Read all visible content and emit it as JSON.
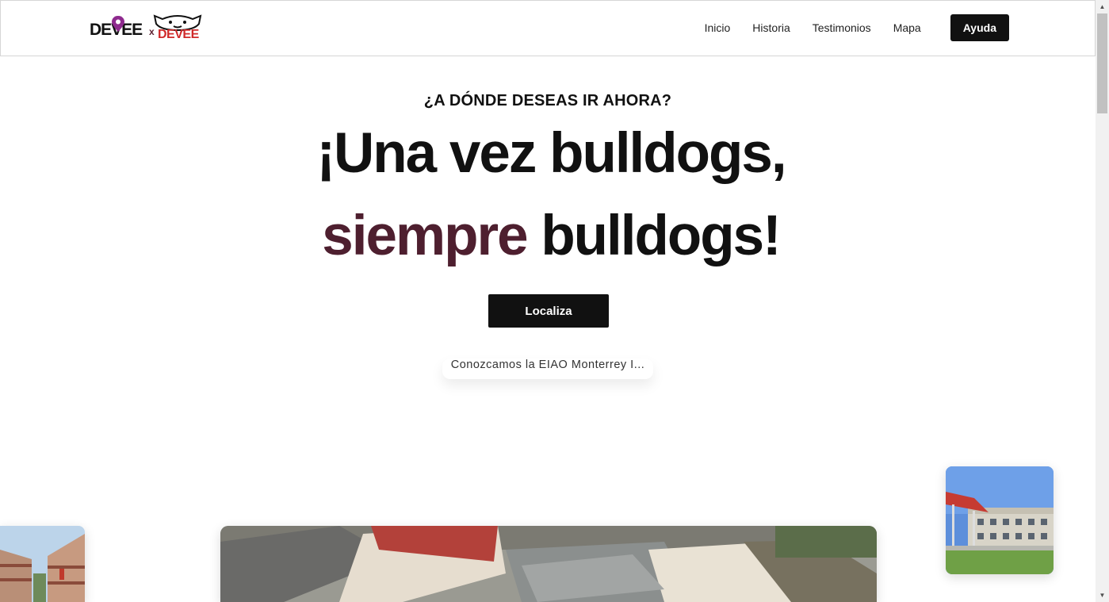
{
  "brand": {
    "logo_part1": "DEVEE",
    "logo_x": "x",
    "logo_part2": "DEVEE"
  },
  "nav": {
    "items": [
      {
        "label": "Inicio"
      },
      {
        "label": "Historia"
      },
      {
        "label": "Testimonios"
      },
      {
        "label": "Mapa"
      }
    ],
    "cta": "Ayuda"
  },
  "hero": {
    "eyebrow": "¿A DÓNDE DESEAS IR AHORA?",
    "line1": "¡Una vez bulldogs,",
    "line2_accent": "siempre",
    "line2_rest": "bulldogs!",
    "button": "Localiza",
    "teaser": "Conozcamos la EIAO Monterrey I..."
  },
  "colors": {
    "accent": "#4e1f2f",
    "primary": "#111111",
    "logo_red": "#d02a2a",
    "logo_pin": "#8e2a8e"
  },
  "images": [
    {
      "name": "campus-corridor-photo"
    },
    {
      "name": "campus-aerial-photo"
    },
    {
      "name": "campus-building-photo"
    }
  ]
}
